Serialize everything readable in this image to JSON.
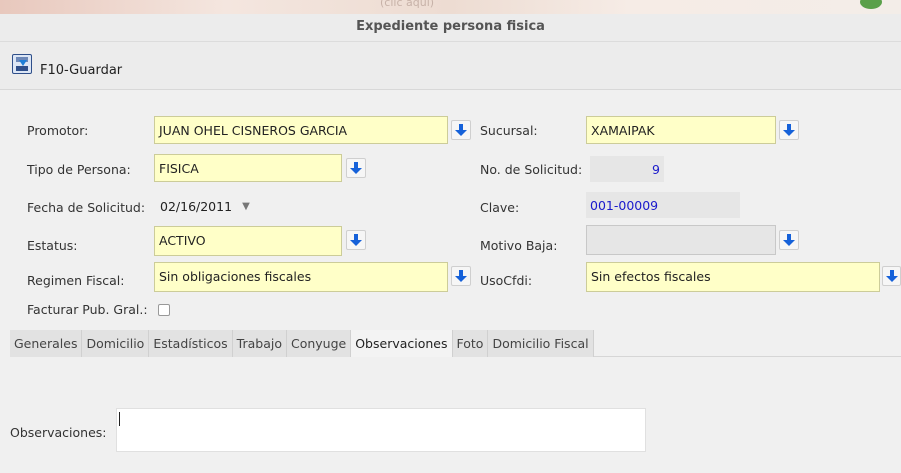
{
  "window": {
    "title": "Expediente persona fisica",
    "header_text": "(clic aqui)"
  },
  "toolbar": {
    "save_label": "F10-Guardar"
  },
  "form": {
    "promotor": {
      "label": "Promotor:",
      "value": "JUAN OHEL CISNEROS GARCIA"
    },
    "sucursal": {
      "label": "Sucursal:",
      "value": "XAMAIPAK"
    },
    "tipo_persona": {
      "label": "Tipo de Persona:",
      "value": "FISICA"
    },
    "no_solicitud": {
      "label": "No. de Solicitud:",
      "value": "9"
    },
    "fecha_solicitud": {
      "label": "Fecha de Solicitud:",
      "value": "02/16/2011",
      "dropdown_glyph": "▼"
    },
    "clave": {
      "label": "Clave:",
      "value": "001-00009"
    },
    "estatus": {
      "label": "Estatus:",
      "value": "ACTIVO"
    },
    "motivo_baja": {
      "label": "Motivo Baja:",
      "value": ""
    },
    "regimen_fiscal": {
      "label": "Regimen Fiscal:",
      "value": "Sin obligaciones fiscales"
    },
    "uso_cfdi": {
      "label": "UsoCfdi:",
      "value": "Sin efectos fiscales"
    },
    "facturar_pub_gral": {
      "label": "Facturar Pub. Gral.:",
      "checked": false
    }
  },
  "tabs": [
    {
      "label": "Generales"
    },
    {
      "label": "Domicilio"
    },
    {
      "label": "Estadísticos"
    },
    {
      "label": "Trabajo"
    },
    {
      "label": "Conyuge"
    },
    {
      "label": "Observaciones",
      "active": true
    },
    {
      "label": "Foto"
    },
    {
      "label": "Domicilio Fiscal"
    }
  ],
  "observaciones": {
    "label": "Observaciones:",
    "value": ""
  },
  "colors": {
    "field_bg": "#ffffc8",
    "arrow": "#1561d9",
    "readonly_text": "#1a1acc"
  }
}
